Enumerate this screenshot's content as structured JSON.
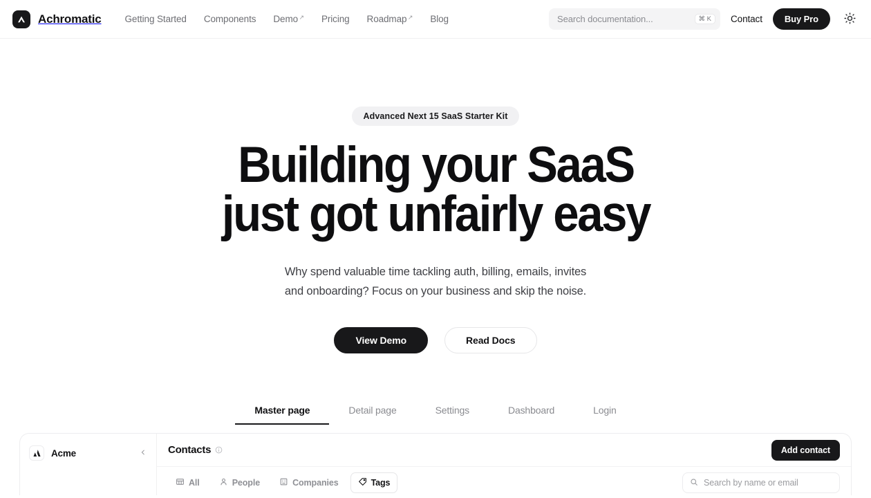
{
  "header": {
    "brand": {
      "name": "Achromatic",
      "logo_icon": "caret-logo-icon"
    },
    "nav": [
      {
        "label": "Getting Started",
        "external": false
      },
      {
        "label": "Components",
        "external": false
      },
      {
        "label": "Demo",
        "external": true,
        "arrow": "↗"
      },
      {
        "label": "Pricing",
        "external": false
      },
      {
        "label": "Roadmap",
        "external": true,
        "arrow": "↗"
      },
      {
        "label": "Blog",
        "external": false
      }
    ],
    "search": {
      "placeholder": "Search documentation...",
      "shortcut": "⌘ K",
      "icon": "search-icon"
    },
    "contact_label": "Contact",
    "buy_pro_label": "Buy Pro",
    "theme_toggle_icon": "sun-icon"
  },
  "hero": {
    "badge": "Advanced Next 15 SaaS Starter Kit",
    "title_line1": "Building your SaaS",
    "title_line2": "just got unfairly easy",
    "subtitle_line1": "Why spend valuable time tackling auth, billing, emails, invites",
    "subtitle_line2": "and onboarding? Focus on your business and skip the noise.",
    "primary_cta": "View Demo",
    "secondary_cta": "Read Docs"
  },
  "preview_tabs": [
    {
      "label": "Master page",
      "active": true
    },
    {
      "label": "Detail page",
      "active": false
    },
    {
      "label": "Settings",
      "active": false
    },
    {
      "label": "Dashboard",
      "active": false
    },
    {
      "label": "Login",
      "active": false
    }
  ],
  "app_preview": {
    "sidebar": {
      "workspace_name": "Acme",
      "workspace_logo_icon": "mountain-logo-icon",
      "collapse_icon": "chevron-left-icon"
    },
    "main": {
      "title": "Contacts",
      "title_info_icon": "info-circle-icon",
      "add_button": "Add contact",
      "filters": [
        {
          "label": "All",
          "icon": "grid-icon",
          "selected": false
        },
        {
          "label": "People",
          "icon": "person-icon",
          "selected": false
        },
        {
          "label": "Companies",
          "icon": "building-icon",
          "selected": false
        },
        {
          "label": "Tags",
          "icon": "tag-icon",
          "selected": true
        }
      ],
      "search_placeholder": "Search by name or email",
      "search_icon": "search-icon"
    }
  },
  "colors": {
    "accent": "#18181a",
    "page_bg": "#ffffff",
    "muted_text": "#8a8b90",
    "badge_bg": "#f1f1f3",
    "border": "#ededef"
  }
}
